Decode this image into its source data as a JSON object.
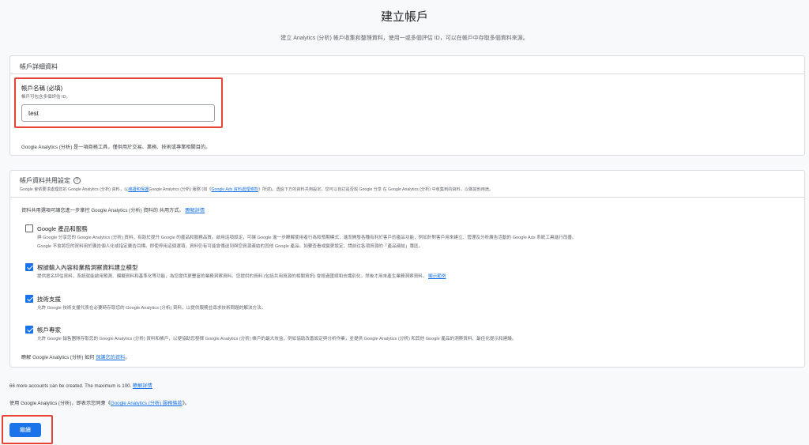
{
  "page": {
    "title": "建立帳戶",
    "subtitle": "建立 Analytics (分析) 帳戶收集和整理資料，使用一或多個評估 ID，可以在帳戶中存取多個資料來源。"
  },
  "account_details": {
    "header": "帳戶詳細資料",
    "name_label": "帳戶名稱 (必填)",
    "name_help": "帳戶可包含多個評估 ID。",
    "name_value": "test",
    "note": "Google Analytics (分析) 是一項商務工具，僅供用於交易、業務、技術或專業相關目的。"
  },
  "data_sharing": {
    "header": "帳戶資料共用設定",
    "help_icon": "?",
    "desc_part1": "Google 會依要求處理您的 Google Analytics (分析) 資料，以",
    "desc_link1": "維護和保護",
    "desc_part2": "Google Analytics (分析) 服務 (如《",
    "desc_link2": "Google Ads 資料處理條款",
    "desc_part3": "》所述)。透過下方的資料共用設定，您可以自訂是否與 Google 分享 在 Google Analytics (分析) 中收集到的資料，以做其他用途。",
    "intro": "資料共用選項可讓您進一步掌控 Google Analytics (分析) 資料的 共用方式。",
    "intro_link": "瞭解詳情",
    "options": [
      {
        "title": "Google 產品和服務",
        "checked": false,
        "desc_line1": "與 Google 分享您的 Google Analytics (分析) 資料，有助於提升 Google 的產品和服務品質。啟用這項設定，可讓 Google 進一步瞭解使用者行為和預期模式，進而開發各種有利於客戶的產品功能，例如針對客戶用來建立、管理及分析廣告活動的 Google Ads 系統工具進行改善。",
        "desc_line2": "Google 不會將您的資料用於廣告個人化或指定廣告目標。即使停用這個選項，資料仍有可能會傳送到與您資源連結的其他 Google 產品。如要查看或變更設定，請前往各項資源的「產品連結」專區。"
      },
      {
        "title": "根據輸入內容和業務洞察資料建立模型",
        "checked": true,
        "desc_line1": "提供匿名評估資料，系統就能啟用預測、模擬資料和基準化等功能，為您提供更豐富的業務洞察資料。您提供的資料 (包括共用資源的相關資訊) 會經過匯總和去識別化，然後才用來產生業務洞察資料。",
        "desc_link": "顯示範例"
      },
      {
        "title": "技術支援",
        "checked": true,
        "desc_line1": "允許 Google 技術支援代表在必要時存取您的 Google Analytics (分析) 資料，以提供服務並尋求技術問題的解決方法。"
      },
      {
        "title": "帳戶專家",
        "checked": true,
        "desc_line1": "允許 Google 銷售團隊存取您的 Google Analytics (分析) 資料和帳戶，以便協助您發揮 Google Analytics (分析) 帳戶的最大效益，例如協助改善設定與分析作業，並提供 Google Analytics (分析) 和其他 Google 產品的洞察資料、最佳化提示和建議。"
      }
    ],
    "protect_text": "瞭解 Google Analytics (分析) 如何",
    "protect_link": "保護您的資料",
    "protect_end": "。"
  },
  "footer": {
    "accounts_text": "66 more accounts can be created. The maximum is 100.",
    "accounts_link": "瞭解詳情",
    "terms_text": "使用 Google Analytics (分析)，即表示您同意《",
    "terms_link": "Google Analytics (分析) 服務條款",
    "terms_end": "》。",
    "continue_label": "繼續"
  },
  "colors": {
    "accent": "#1a73e8",
    "highlight": "#ea4335"
  }
}
